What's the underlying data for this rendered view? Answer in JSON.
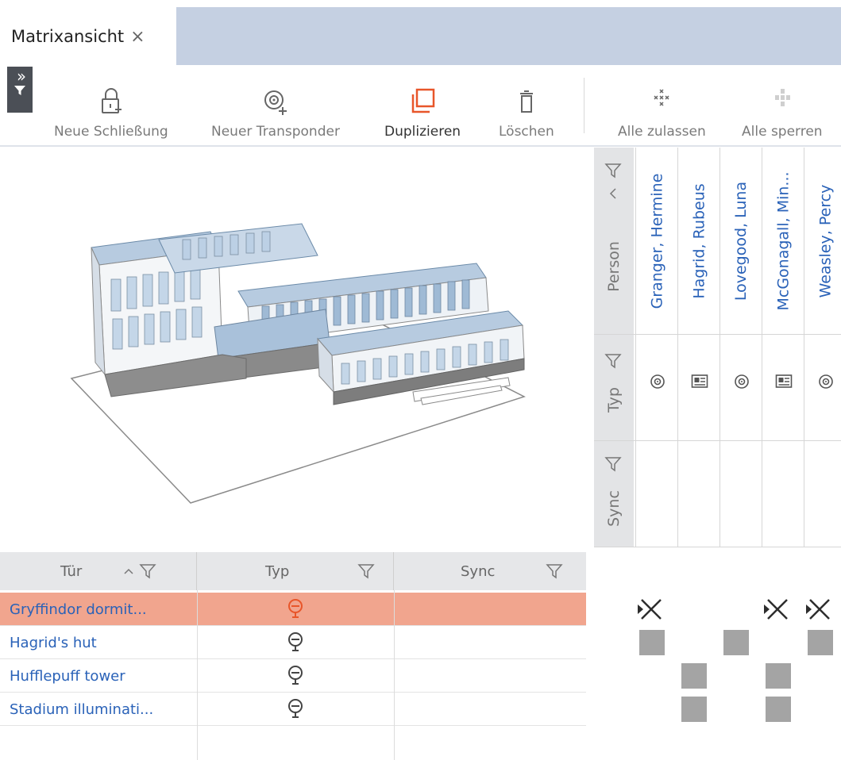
{
  "tabs": [
    {
      "label": "Matrixansicht",
      "close": "×"
    }
  ],
  "toolbar": {
    "sidebar_toggle": {
      "icon": "double-chevron-right-icon",
      "filter_icon": "filter-icon"
    },
    "buttons": [
      {
        "id": "neue-schliessung",
        "label": "Neue Schließung",
        "icon": "lock-plus-icon"
      },
      {
        "id": "neuer-transponder",
        "label": "Neuer Transponder",
        "icon": "transponder-plus-icon"
      },
      {
        "id": "duplizieren",
        "label": "Duplizieren",
        "icon": "duplicate-icon"
      },
      {
        "id": "loeschen",
        "label": "Löschen",
        "icon": "trash-icon"
      },
      {
        "id": "alle-zulassen",
        "label": "Alle zulassen",
        "icon": "cross-grid-icon"
      },
      {
        "id": "alle-sperren",
        "label": "Alle sperren",
        "icon": "dots-grid-icon"
      }
    ]
  },
  "matrix_header": {
    "labels": {
      "person": "Person",
      "typ": "Typ",
      "sync": "Sync"
    },
    "sort_icon": "chevron-up-icon",
    "persons": [
      {
        "name": "Granger, Hermine",
        "type": "transponder"
      },
      {
        "name": "Hagrid, Rubeus",
        "type": "card"
      },
      {
        "name": "Lovegood, Luna",
        "type": "transponder"
      },
      {
        "name": "McGonagall, Min...",
        "type": "card"
      },
      {
        "name": "Weasley, Percy",
        "type": "transponder"
      }
    ]
  },
  "door_table": {
    "columns": [
      {
        "label": "Tür",
        "sort": "ascending"
      },
      {
        "label": "Typ"
      },
      {
        "label": "Sync"
      }
    ],
    "rows": [
      {
        "name": "Gryffindor dormit...",
        "selected": true
      },
      {
        "name": "Hagrid's hut",
        "selected": false
      },
      {
        "name": "Hufflepuff tower",
        "selected": false
      },
      {
        "name": "Stadium illuminati...",
        "selected": false
      }
    ]
  },
  "permissions": [
    [
      "x",
      "",
      "",
      "x",
      "x"
    ],
    [
      "g",
      "",
      "g",
      "",
      "g"
    ],
    [
      "",
      "g",
      "",
      "g",
      ""
    ],
    [
      "",
      "g",
      "",
      "g",
      ""
    ]
  ],
  "colors": {
    "accent": "#e8562a",
    "selected_row": "#f1a58e",
    "link": "#2a62b8",
    "tab_strip": "#c5d0e2",
    "header_bg": "#e3e4e6",
    "permission_cell": "#a4a4a4"
  }
}
